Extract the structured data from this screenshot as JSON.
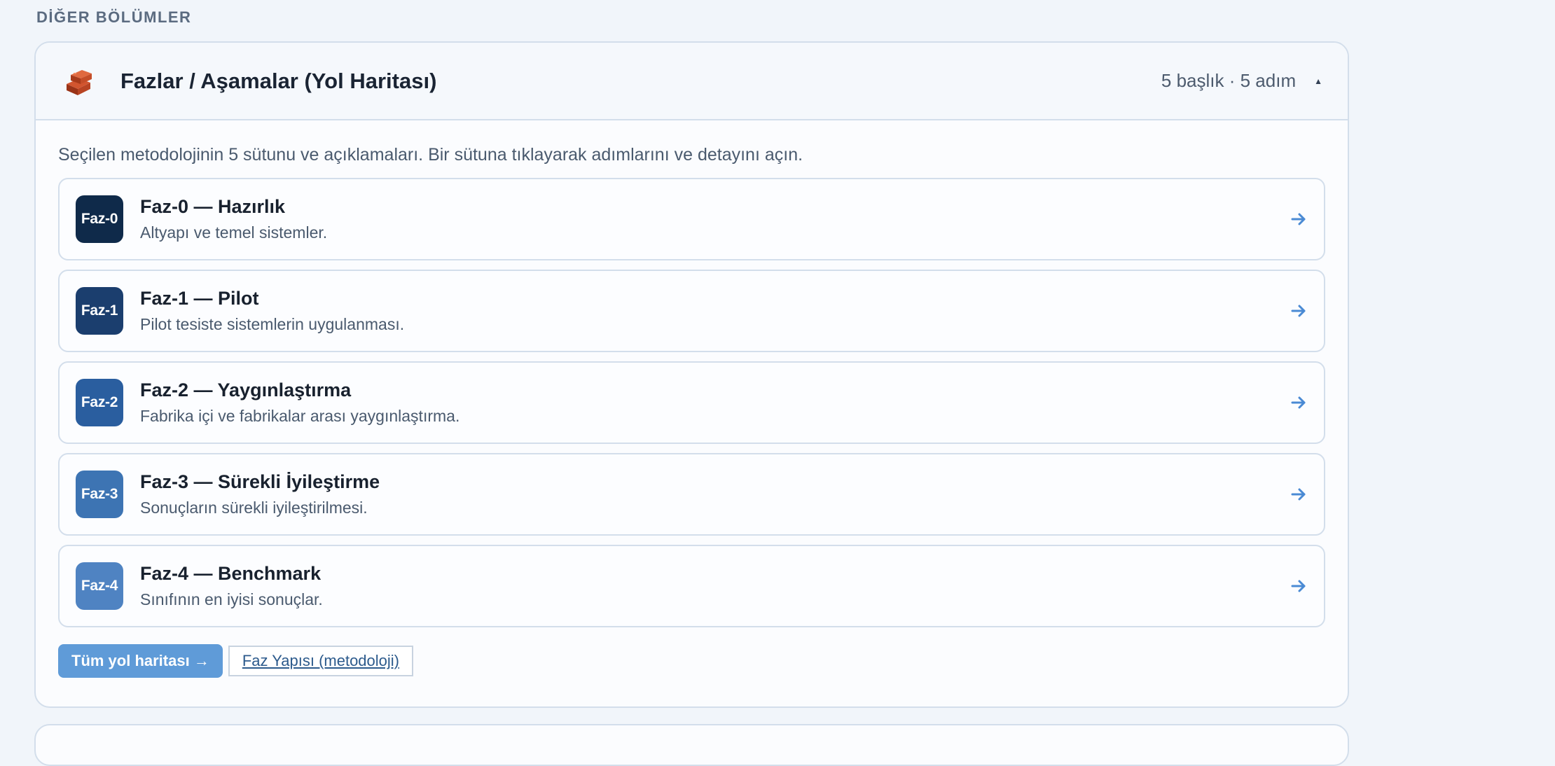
{
  "section": {
    "heading": "DİĞER BÖLÜMLER"
  },
  "card": {
    "icon": "bricks-icon",
    "title": "Fazlar / Aşamalar (Yol Haritası)",
    "meta": "5 başlık · 5 adım",
    "collapse_glyph": "▲",
    "intro": "Seçilen metodolojinin 5 sütunu ve açıklamaları. Bir sütuna tıklayarak adımlarını ve detayını açın.",
    "phases": [
      {
        "badge": "Faz-0",
        "title": "Faz-0 — Hazırlık",
        "desc": "Altyapı ve temel sistemler.",
        "color": "#0f2a4a"
      },
      {
        "badge": "Faz-1",
        "title": "Faz-1 — Pilot",
        "desc": "Pilot tesiste sistemlerin uygulanması.",
        "color": "#1b3e6e"
      },
      {
        "badge": "Faz-2",
        "title": "Faz-2 — Yaygınlaştırma",
        "desc": "Fabrika içi ve fabrikalar arası yaygınlaştırma.",
        "color": "#2a5e9f"
      },
      {
        "badge": "Faz-3",
        "title": "Faz-3 — Sürekli İyileştirme",
        "desc": "Sonuçların sürekli iyileştirilmesi.",
        "color": "#3d74b3"
      },
      {
        "badge": "Faz-4",
        "title": "Faz-4 — Benchmark",
        "desc": "Sınıfının en iyisi sonuçlar.",
        "color": "#4f83c2"
      }
    ],
    "actions": {
      "roadmap_button": "Tüm yol haritası →",
      "structure_link": "Faz Yapısı (metodoloji)"
    }
  },
  "colors": {
    "accent": "#5f9bd8",
    "arrow": "#4a8ad4",
    "border": "#d3deeb",
    "background": "#f1f5fa"
  }
}
